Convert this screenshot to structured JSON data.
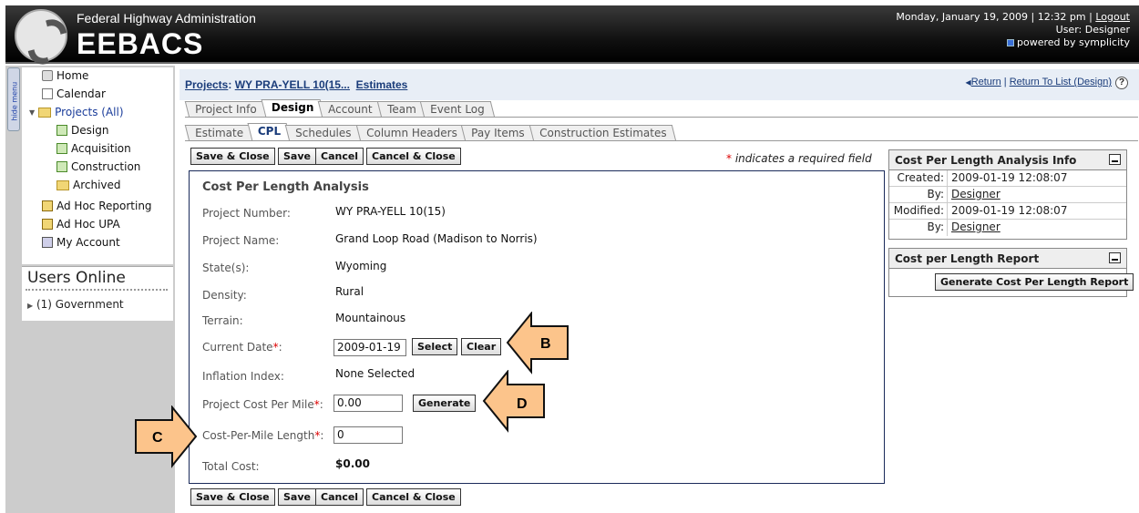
{
  "header": {
    "org": "Federal Highway Administration",
    "brand": "EEBACS",
    "datetime": "Monday, January 19, 2009 | 12:32 pm |",
    "logout": "Logout",
    "user": "User: Designer",
    "powered": "powered by symplicity"
  },
  "sidebar": {
    "hide_menu": "hide menu",
    "items": [
      {
        "label": "Home",
        "icon": "home-icon"
      },
      {
        "label": "Calendar",
        "icon": "calendar-icon"
      },
      {
        "label": "Projects (All)",
        "icon": "folder-icon"
      },
      {
        "label": "Design",
        "icon": "document-icon"
      },
      {
        "label": "Acquisition",
        "icon": "document-icon"
      },
      {
        "label": "Construction",
        "icon": "document-icon"
      },
      {
        "label": "Archived",
        "icon": "folder-icon"
      },
      {
        "label": "Ad Hoc Reporting",
        "icon": "report-icon"
      },
      {
        "label": "Ad Hoc UPA",
        "icon": "report-icon"
      },
      {
        "label": "My Account",
        "icon": "account-icon"
      }
    ],
    "users_online": "Users Online",
    "government": "(1) Government"
  },
  "breadcrumb": {
    "projects": "Projects",
    "colon": ": ",
    "project": "WY PRA-YELL 10(15...",
    "estimates": "Estimates"
  },
  "return_links": {
    "ret": "Return",
    "sep": " | ",
    "ret_list": "Return To List (Design)"
  },
  "tabs_primary": [
    "Project Info",
    "Design",
    "Account",
    "Team",
    "Event Log"
  ],
  "tabs_secondary": [
    "Estimate",
    "CPL",
    "Schedules",
    "Column Headers",
    "Pay Items",
    "Construction Estimates"
  ],
  "buttons": {
    "save_close": "Save & Close",
    "save": "Save",
    "cancel": "Cancel",
    "cancel_close": "Cancel & Close"
  },
  "required_note": {
    "star": "*",
    "text": " indicates a required field"
  },
  "form": {
    "title": "Cost Per Length Analysis",
    "project_number_label": "Project Number:",
    "project_number": "WY PRA-YELL 10(15)",
    "project_name_label": "Project Name:",
    "project_name": "Grand Loop Road (Madison to Norris)",
    "states_label": "State(s):",
    "states": "Wyoming",
    "density_label": "Density:",
    "density": "Rural",
    "terrain_label": "Terrain:",
    "terrain": "Mountainous",
    "current_date_label": "Current Date",
    "current_date": "2009-01-19",
    "select": "Select",
    "clear": "Clear",
    "inflation_label": "Inflation Index:",
    "inflation": "None Selected",
    "cost_per_mile_label": "Project Cost Per Mile",
    "cost_per_mile": "0.00",
    "generate": "Generate",
    "cpm_length_label": "Cost-Per-Mile Length",
    "cpm_length": "0",
    "total_label": "Total Cost:",
    "total": "$0.00",
    "star": "*",
    "colon": ":"
  },
  "info_panel": {
    "title": "Cost Per Length Analysis Info",
    "created_label": "Created:",
    "created": "2009-01-19 12:08:07",
    "by_label": "By:",
    "created_by": "Designer",
    "modified_label": "Modified:",
    "modified": "2009-01-19 12:08:07",
    "modified_by": "Designer"
  },
  "report_panel": {
    "title": "Cost per Length Report",
    "button": "Generate Cost Per Length Report"
  },
  "callouts": {
    "b": "B",
    "c": "C",
    "d": "D"
  },
  "colors": {
    "link": "#1a3c7a",
    "required": "#dd0000",
    "callout_fill": "#fcc48b"
  }
}
